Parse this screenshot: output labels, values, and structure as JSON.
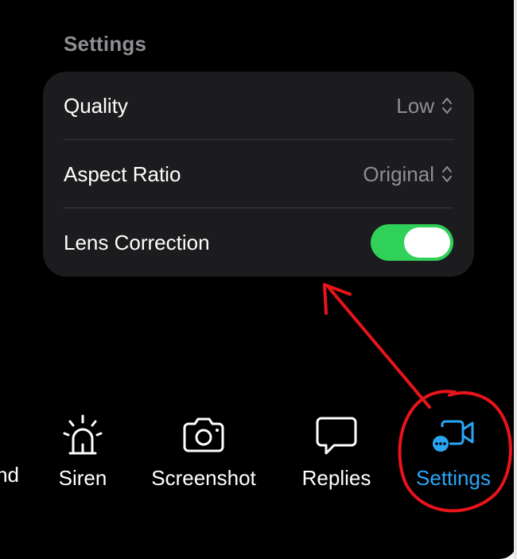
{
  "settings": {
    "title": "Settings",
    "rows": [
      {
        "label": "Quality",
        "value": "Low"
      },
      {
        "label": "Aspect Ratio",
        "value": "Original"
      },
      {
        "label": "Lens Correction",
        "toggle_on": true
      }
    ]
  },
  "tabs": [
    {
      "label": "nd",
      "icon": "clock-icon"
    },
    {
      "label": "Siren",
      "icon": "siren-icon"
    },
    {
      "label": "Screenshot",
      "icon": "camera-icon"
    },
    {
      "label": "Replies",
      "icon": "speech-bubble-icon"
    },
    {
      "label": "Settings",
      "icon": "video-settings-icon",
      "active": true
    }
  ],
  "colors": {
    "accent": "#2aa6f5",
    "toggle": "#30d158",
    "annotation": "#e8141b"
  }
}
